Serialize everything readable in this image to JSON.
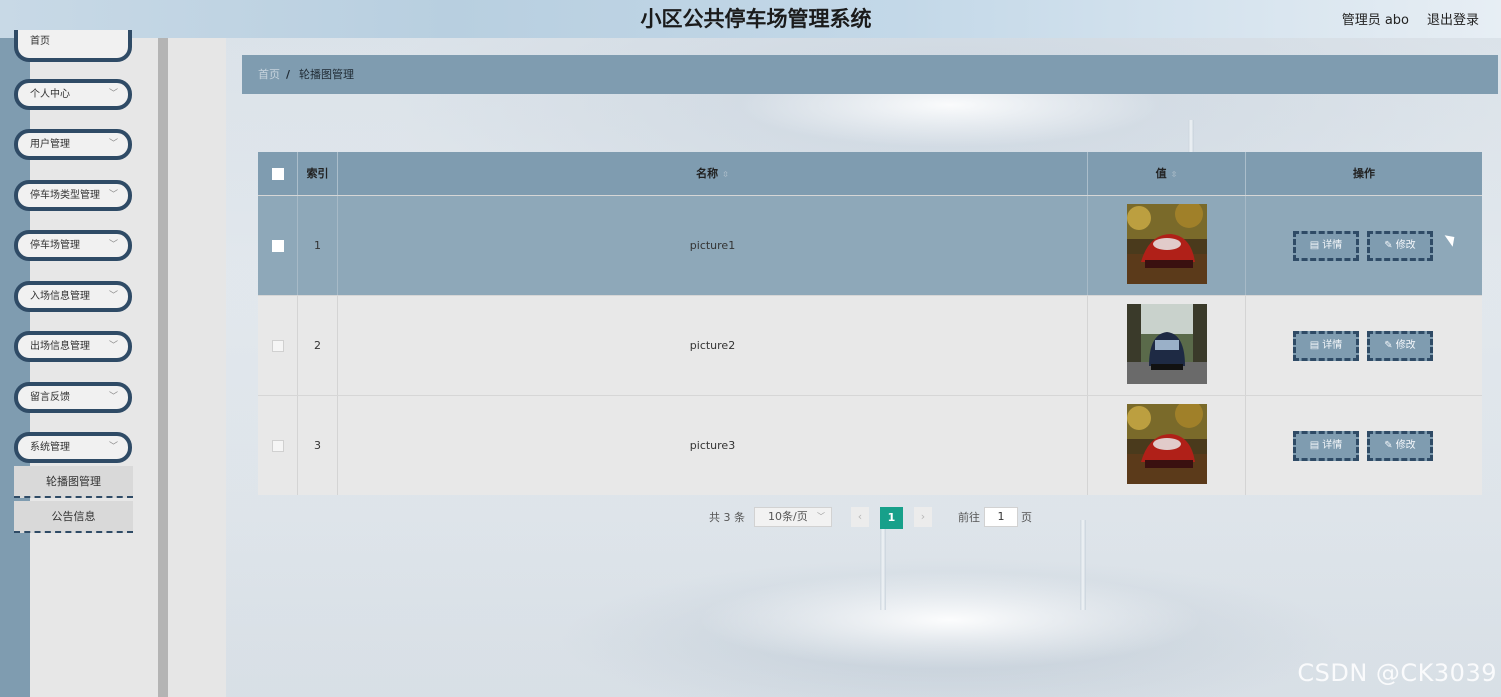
{
  "header": {
    "title": "小区公共停车场管理系统",
    "user": "管理员 abo",
    "logout": "退出登录"
  },
  "sidebar": {
    "items": [
      {
        "label": "首页"
      },
      {
        "label": "个人中心"
      },
      {
        "label": "用户管理"
      },
      {
        "label": "停车场类型管理"
      },
      {
        "label": "停车场管理"
      },
      {
        "label": "入场信息管理"
      },
      {
        "label": "出场信息管理"
      },
      {
        "label": "留言反馈"
      },
      {
        "label": "系统管理"
      }
    ],
    "sub_items": [
      {
        "label": "轮播图管理"
      },
      {
        "label": "公告信息"
      }
    ]
  },
  "breadcrumb": {
    "home": "首页",
    "separator": "/",
    "current": "轮播图管理"
  },
  "table": {
    "headers": {
      "index": "索引",
      "name": "名称",
      "value": "值",
      "actions": "操作"
    },
    "rows": [
      {
        "index": "1",
        "name": "picture1",
        "selected": true
      },
      {
        "index": "2",
        "name": "picture2",
        "selected": false
      },
      {
        "index": "3",
        "name": "picture3",
        "selected": false
      }
    ],
    "detail_label": "详情",
    "edit_label": "修改"
  },
  "pagination": {
    "total": "共 3 条",
    "page_size": "10条/页",
    "current_page": "1",
    "goto_label": "前往",
    "goto_value": "1",
    "page_suffix": "页"
  },
  "watermark": "CSDN @CK3039",
  "colors": {
    "accent": "#7f9cb0",
    "border_dark": "#2f4b66",
    "page_active": "#17a08a"
  }
}
